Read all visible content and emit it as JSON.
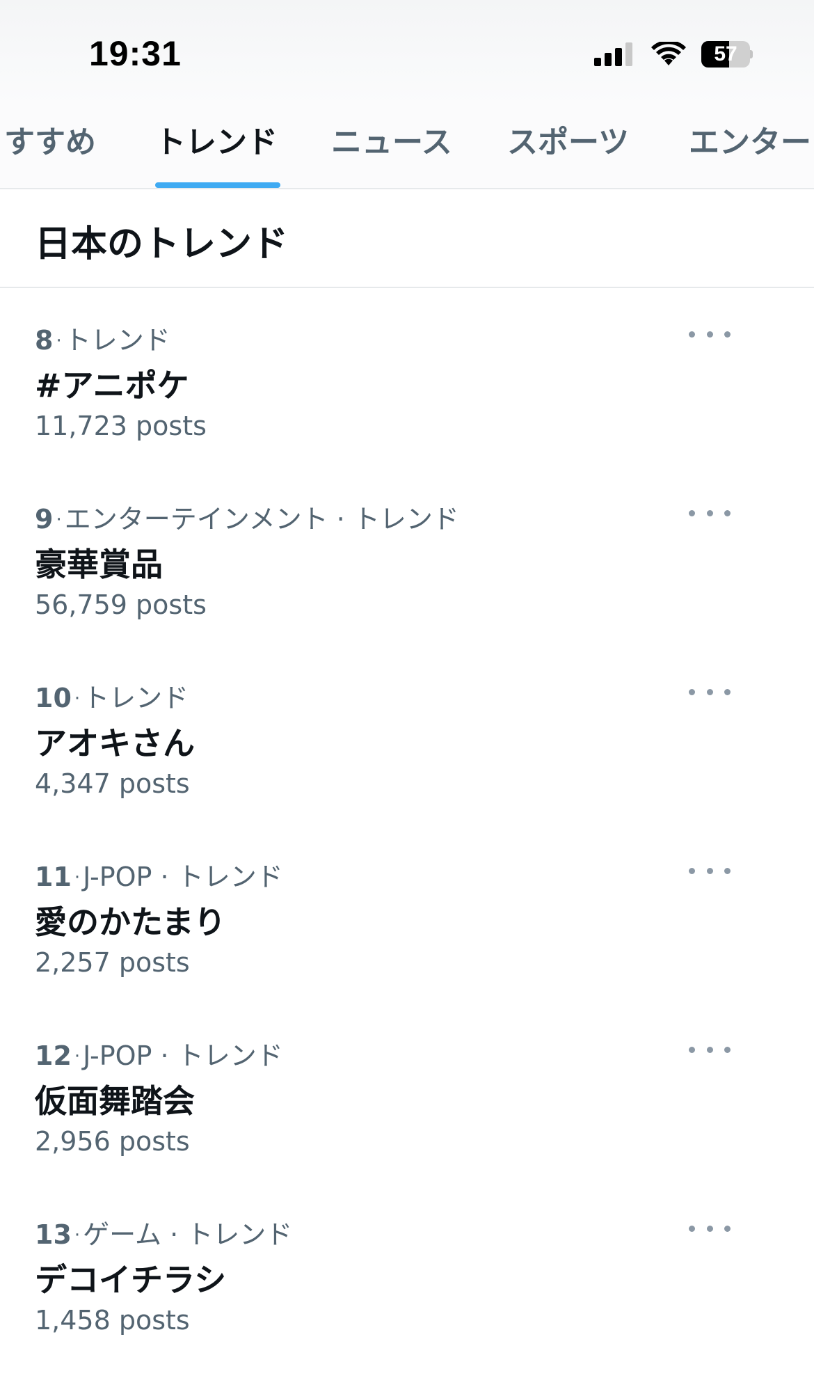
{
  "status_bar": {
    "time": "19:31",
    "battery_level": "57",
    "battery_fraction": 0.57,
    "icons": [
      "cellular-signal-icon",
      "wifi-icon",
      "battery-icon"
    ]
  },
  "tabs": [
    {
      "label": "すすめ",
      "active": false
    },
    {
      "label": "トレンド",
      "active": true
    },
    {
      "label": "ニュース",
      "active": false
    },
    {
      "label": "スポーツ",
      "active": false
    },
    {
      "label": "エンター",
      "active": false
    }
  ],
  "section": {
    "title": "日本のトレンド"
  },
  "separator": "·",
  "trends": [
    {
      "rank": "8",
      "category": "トレンド",
      "name": "#アニポケ",
      "posts": "11,723 posts"
    },
    {
      "rank": "9",
      "category": "エンターテインメント · トレンド",
      "name": "豪華賞品",
      "posts": "56,759 posts"
    },
    {
      "rank": "10",
      "category": "トレンド",
      "name": "アオキさん",
      "posts": "4,347 posts"
    },
    {
      "rank": "11",
      "category": "J-POP · トレンド",
      "name": "愛のかたまり",
      "posts": "2,257 posts"
    },
    {
      "rank": "12",
      "category": "J-POP · トレンド",
      "name": "仮面舞踏会",
      "posts": "2,956 posts"
    },
    {
      "rank": "13",
      "category": "ゲーム · トレンド",
      "name": "デコイチラシ",
      "posts": "1,458 posts"
    }
  ],
  "colors": {
    "accent": "#1d9bf0",
    "text_primary": "#0f1419",
    "text_secondary": "#536471",
    "divider": "#e6e9eb"
  }
}
